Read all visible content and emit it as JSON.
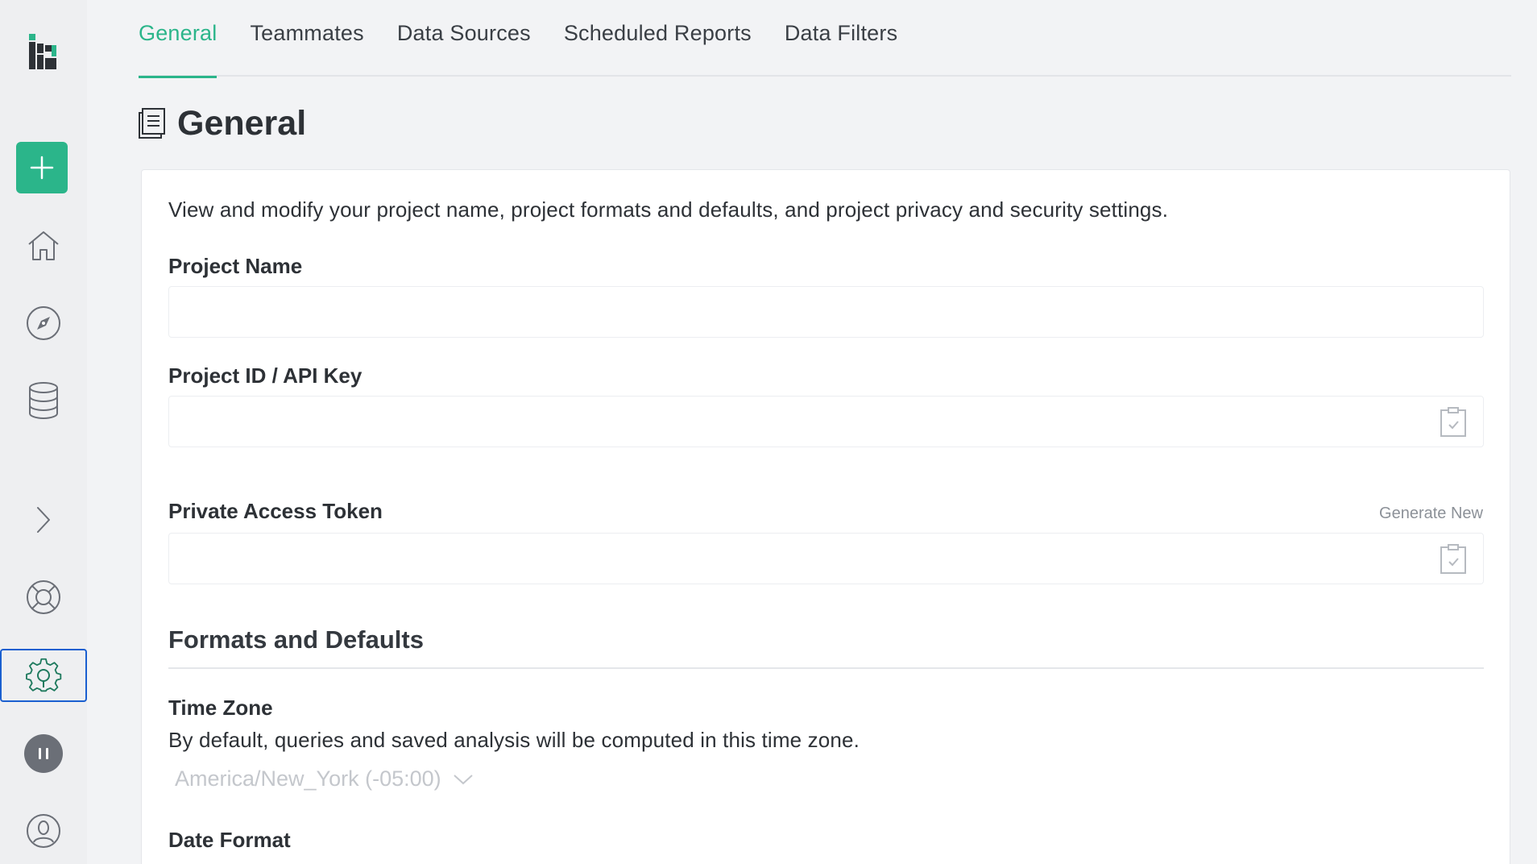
{
  "sidebar": {
    "icons": [
      "logo-icon",
      "plus-icon",
      "home-icon",
      "compass-icon",
      "database-icon",
      "chevron-right-icon",
      "lifebuoy-icon",
      "gear-icon",
      "pause-icon",
      "user-icon"
    ],
    "accent": "#2bb58a"
  },
  "tabs": [
    {
      "label": "General",
      "active": true
    },
    {
      "label": "Teammates",
      "active": false
    },
    {
      "label": "Data Sources",
      "active": false
    },
    {
      "label": "Scheduled Reports",
      "active": false
    },
    {
      "label": "Data Filters",
      "active": false
    }
  ],
  "header": {
    "title": "General",
    "icon": "document-icon"
  },
  "card": {
    "description": "View and modify your project name, project formats and defaults, and project privacy and security settings.",
    "project_name": {
      "label": "Project Name",
      "value": ""
    },
    "project_id": {
      "label": "Project ID / API Key",
      "value": ""
    },
    "private_token": {
      "label": "Private Access Token",
      "value": "",
      "generate_label": "Generate New"
    },
    "formats_section": {
      "title": "Formats and Defaults"
    },
    "time_zone": {
      "label": "Time Zone",
      "help": "By default, queries and saved analysis will be computed in this time zone.",
      "selected": "America/New_York (-05:00)"
    },
    "date_format": {
      "label": "Date Format"
    }
  }
}
